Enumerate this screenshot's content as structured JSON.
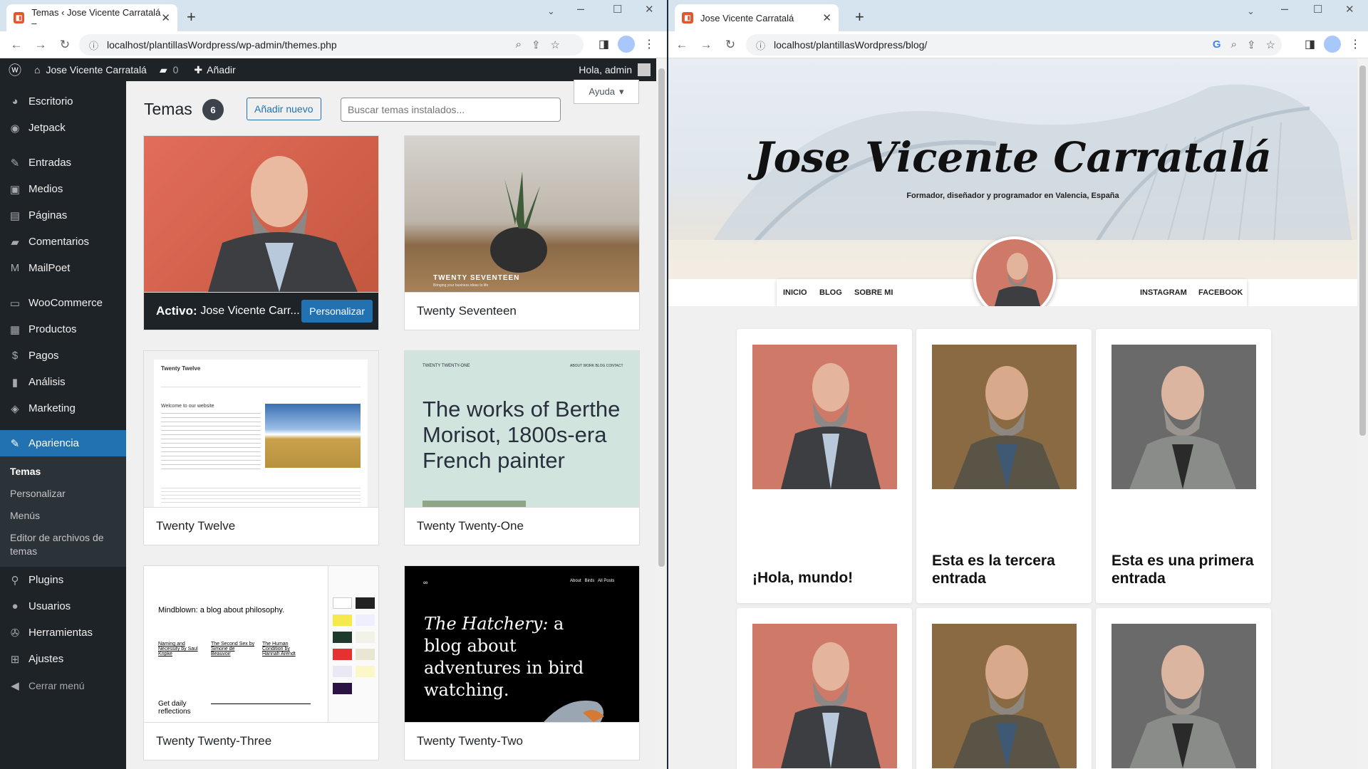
{
  "left_window": {
    "tab_title": "Temas ‹ Jose Vicente Carratalá –",
    "url": "localhost/plantillasWordpress/wp-admin/themes.php",
    "adminbar": {
      "site_name": "Jose Vicente Carratalá",
      "comments": "0",
      "add_new": "Añadir",
      "greeting": "Hola, admin"
    },
    "menu": [
      {
        "label": "Escritorio",
        "icon": "dashboard-icon"
      },
      {
        "label": "Jetpack",
        "icon": "jetpack-icon"
      },
      {
        "label": "Entradas",
        "icon": "pin-icon"
      },
      {
        "label": "Medios",
        "icon": "media-icon"
      },
      {
        "label": "Páginas",
        "icon": "page-icon"
      },
      {
        "label": "Comentarios",
        "icon": "comment-icon"
      },
      {
        "label": "MailPoet",
        "icon": "mailpoet-icon"
      },
      {
        "label": "WooCommerce",
        "icon": "woo-icon"
      },
      {
        "label": "Productos",
        "icon": "archive-icon"
      },
      {
        "label": "Pagos",
        "icon": "dollar-icon"
      },
      {
        "label": "Análisis",
        "icon": "chart-icon"
      },
      {
        "label": "Marketing",
        "icon": "megaphone-icon"
      },
      {
        "label": "Apariencia",
        "icon": "brush-icon"
      },
      {
        "label": "Plugins",
        "icon": "plugin-icon"
      },
      {
        "label": "Usuarios",
        "icon": "user-icon"
      },
      {
        "label": "Herramientas",
        "icon": "wrench-icon"
      },
      {
        "label": "Ajustes",
        "icon": "settings-icon"
      },
      {
        "label": "Cerrar menú",
        "icon": "collapse-icon"
      }
    ],
    "submenu": [
      "Temas",
      "Personalizar",
      "Menús",
      "Editor de archivos de temas"
    ],
    "page": {
      "title": "Temas",
      "count": "6",
      "add_button": "Añadir nuevo",
      "search_placeholder": "Buscar temas instalados...",
      "help": "Ayuda"
    },
    "themes": [
      {
        "name": "Activo: Jose Vicente Carr...",
        "active_prefix": "Activo:",
        "active_name": "Jose Vicente Carr...",
        "action": "Personalizar"
      },
      {
        "name": "Twenty Seventeen",
        "preview_title": "TWENTY SEVENTEEN",
        "preview_sub": "Bringing your business ideas to life"
      },
      {
        "name": "Twenty Twelve",
        "preview_title": "Twenty Twelve",
        "preview_heading": "Welcome to our website"
      },
      {
        "name": "Twenty Twenty-One",
        "preview_title": "TWENTY TWENTY-ONE",
        "preview_text": "The works of Berthe Morisot, 1800s-era French painter",
        "preview_nav": "ABOUT  WORK  BLOG  CONTACT"
      },
      {
        "name": "Twenty Twenty-Three",
        "preview_text": "Mindblown: a blog about philosophy.",
        "preview_footer": "Get daily reflections",
        "preview_book1": "Naming and Necessity by Saul Kripke",
        "preview_book2": "The Second Sex by Simone de Beauvoir",
        "preview_book3": "The Human Condition by Hannah Arendt"
      },
      {
        "name": "Twenty Twenty-Two",
        "preview_text_italic": "The Hatchery:",
        "preview_text": "a blog about adventures in bird watching.",
        "preview_nav": "About   Birds   All Posts"
      }
    ]
  },
  "right_window": {
    "tab_title": "Jose Vicente Carratalá",
    "url": "localhost/plantillasWordpress/blog/",
    "site_title": "Jose Vicente Carratalá",
    "tagline": "Formador, diseñador y programador en Valencia, España",
    "nav_left": [
      "INICIO",
      "BLOG",
      "SOBRE MI"
    ],
    "nav_right": [
      "INSTAGRAM",
      "FACEBOOK"
    ],
    "posts": [
      {
        "title": "¡Hola, mundo!",
        "bg": "#cf7a68"
      },
      {
        "title": "Esta es la tercera entrada",
        "bg": "#8a6a43"
      },
      {
        "title": "Esta es una primera entrada",
        "bg": "#6a6a6a"
      }
    ]
  },
  "colors": {
    "wp_dark": "#1d2327",
    "wp_blue": "#2271b1",
    "chrome_tab": "#d6e4ef"
  }
}
